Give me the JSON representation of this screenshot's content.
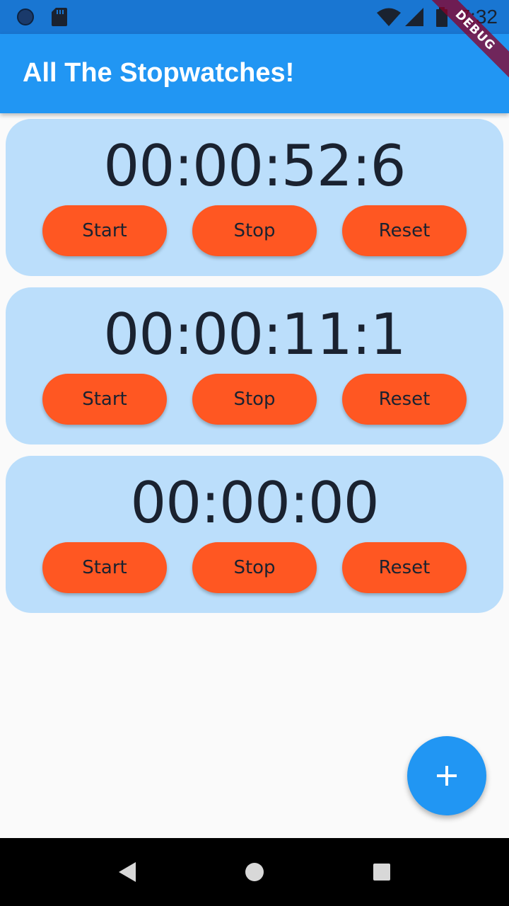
{
  "status_bar": {
    "time": "7:32",
    "icons": [
      "sync-icon",
      "sd-card-icon",
      "wifi-icon",
      "signal-icon",
      "battery-icon"
    ]
  },
  "app_bar": {
    "title": "All The Stopwatches!"
  },
  "debug_banner": "DEBUG",
  "stopwatches": [
    {
      "time": "00:00:52:6",
      "start_label": "Start",
      "stop_label": "Stop",
      "reset_label": "Reset"
    },
    {
      "time": "00:00:11:1",
      "start_label": "Start",
      "stop_label": "Stop",
      "reset_label": "Reset"
    },
    {
      "time": "00:00:00",
      "start_label": "Start",
      "stop_label": "Stop",
      "reset_label": "Reset"
    }
  ],
  "fab": {
    "icon": "plus-icon"
  },
  "nav_bar": {
    "icons": [
      "back-icon",
      "home-icon",
      "recents-icon"
    ]
  },
  "colors": {
    "app_bar": "#2196f3",
    "status_bar": "#1976d2",
    "card": "#bbdefb",
    "button": "#ff5722",
    "fab": "#2196f3"
  }
}
